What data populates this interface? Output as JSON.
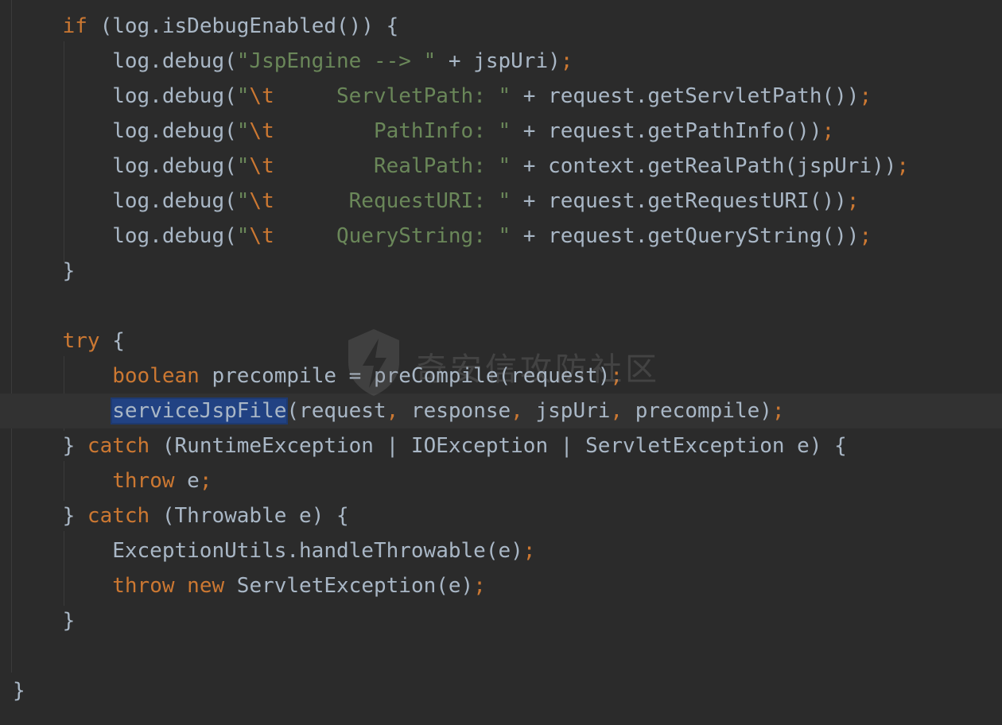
{
  "editor": {
    "colors": {
      "background": "#2b2b2b",
      "current_line": "#323232",
      "keyword": "#cc7832",
      "string": "#6a8759",
      "text": "#a9b7c6",
      "selection": "#214283"
    },
    "lines": [
      [
        {
          "t": "    "
        },
        {
          "t": "if",
          "k": "keyword"
        },
        {
          "t": " (log.isDebugEnabled()) {"
        }
      ],
      [
        {
          "t": "        log.debug("
        },
        {
          "t": "\"JspEngine --> \"",
          "k": "string"
        },
        {
          "t": " + jspUri)"
        },
        {
          "t": ";",
          "k": "punct"
        }
      ],
      [
        {
          "t": "        log.debug("
        },
        {
          "t": "\"",
          "k": "string"
        },
        {
          "t": "\\t",
          "k": "escape"
        },
        {
          "t": "     ServletPath: \"",
          "k": "string"
        },
        {
          "t": " + request.getServletPath())"
        },
        {
          "t": ";",
          "k": "punct"
        }
      ],
      [
        {
          "t": "        log.debug("
        },
        {
          "t": "\"",
          "k": "string"
        },
        {
          "t": "\\t",
          "k": "escape"
        },
        {
          "t": "        PathInfo: \"",
          "k": "string"
        },
        {
          "t": " + request.getPathInfo())"
        },
        {
          "t": ";",
          "k": "punct"
        }
      ],
      [
        {
          "t": "        log.debug("
        },
        {
          "t": "\"",
          "k": "string"
        },
        {
          "t": "\\t",
          "k": "escape"
        },
        {
          "t": "        RealPath: \"",
          "k": "string"
        },
        {
          "t": " + context.getRealPath(jspUri))"
        },
        {
          "t": ";",
          "k": "punct"
        }
      ],
      [
        {
          "t": "        log.debug("
        },
        {
          "t": "\"",
          "k": "string"
        },
        {
          "t": "\\t",
          "k": "escape"
        },
        {
          "t": "      RequestURI: \"",
          "k": "string"
        },
        {
          "t": " + request.getRequestURI())"
        },
        {
          "t": ";",
          "k": "punct"
        }
      ],
      [
        {
          "t": "        log.debug("
        },
        {
          "t": "\"",
          "k": "string"
        },
        {
          "t": "\\t",
          "k": "escape"
        },
        {
          "t": "     QueryString: \"",
          "k": "string"
        },
        {
          "t": " + request.getQueryString())"
        },
        {
          "t": ";",
          "k": "punct"
        }
      ],
      [
        {
          "t": "    }"
        }
      ],
      [],
      [
        {
          "t": "    "
        },
        {
          "t": "try",
          "k": "keyword"
        },
        {
          "t": " {"
        }
      ],
      [
        {
          "t": "        "
        },
        {
          "t": "boolean",
          "k": "keyword"
        },
        {
          "t": " precompile = preCompile(request)"
        },
        {
          "t": ";",
          "k": "punct"
        }
      ],
      [
        {
          "t": "        "
        },
        {
          "t": "serviceJspFile",
          "k": "selected"
        },
        {
          "t": "(request"
        },
        {
          "t": ",",
          "k": "punct"
        },
        {
          "t": " response"
        },
        {
          "t": ",",
          "k": "punct"
        },
        {
          "t": " jspUri"
        },
        {
          "t": ",",
          "k": "punct"
        },
        {
          "t": " precompile)"
        },
        {
          "t": ";",
          "k": "punct"
        }
      ],
      [
        {
          "t": "    } "
        },
        {
          "t": "catch",
          "k": "keyword"
        },
        {
          "t": " (RuntimeException | IOException | ServletException e) {"
        }
      ],
      [
        {
          "t": "        "
        },
        {
          "t": "throw",
          "k": "keyword"
        },
        {
          "t": " e"
        },
        {
          "t": ";",
          "k": "punct"
        }
      ],
      [
        {
          "t": "    } "
        },
        {
          "t": "catch",
          "k": "keyword"
        },
        {
          "t": " (Throwable e) {"
        }
      ],
      [
        {
          "t": "        ExceptionUtils.handleThrowable(e)"
        },
        {
          "t": ";",
          "k": "punct"
        }
      ],
      [
        {
          "t": "        "
        },
        {
          "t": "throw",
          "k": "keyword"
        },
        {
          "t": " "
        },
        {
          "t": "new",
          "k": "keyword"
        },
        {
          "t": " ServletException(e)"
        },
        {
          "t": ";",
          "k": "punct"
        }
      ],
      [
        {
          "t": "    }"
        }
      ],
      [],
      [
        {
          "t": "}"
        }
      ]
    ],
    "current_line_index": 11
  },
  "watermark": {
    "text": "奇安信攻防社区",
    "icon": "lightning-shield-logo"
  }
}
